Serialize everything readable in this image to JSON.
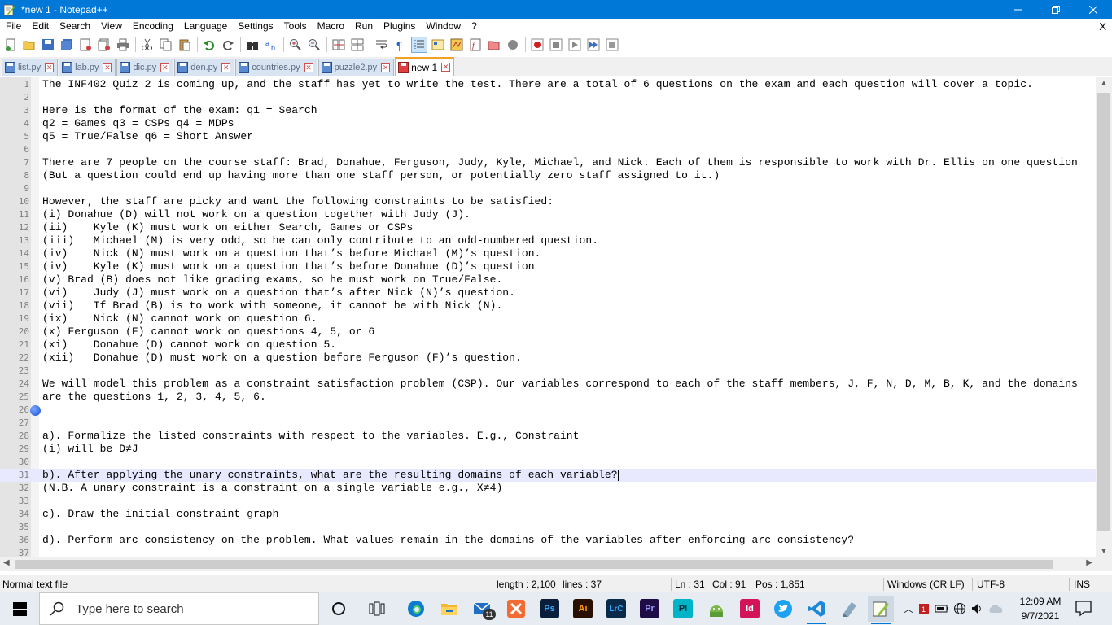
{
  "window": {
    "title": "*new 1 - Notepad++",
    "minimize": "—",
    "restore": "❐",
    "close": "✕"
  },
  "menu": {
    "items": [
      "File",
      "Edit",
      "Search",
      "View",
      "Encoding",
      "Language",
      "Settings",
      "Tools",
      "Macro",
      "Run",
      "Plugins",
      "Window",
      "?"
    ],
    "close_doc": "X"
  },
  "tabs": [
    {
      "label": "list.py",
      "active": false
    },
    {
      "label": "lab.py",
      "active": false
    },
    {
      "label": "dic.py",
      "active": false
    },
    {
      "label": "den.py",
      "active": false
    },
    {
      "label": "countries.py",
      "active": false
    },
    {
      "label": "puzzle2.py",
      "active": false
    },
    {
      "label": "new 1",
      "active": true
    }
  ],
  "editor": {
    "current_line": 31,
    "bookmark_line": 26,
    "lines": [
      "The INF402 Quiz 2 is coming up, and the staff has yet to write the test. There are a total of 6 questions on the exam and each question will cover a topic.",
      "",
      "Here is the format of the exam: q1 = Search",
      "q2 = Games q3 = CSPs q4 = MDPs",
      "q5 = True/False q6 = Short Answer",
      "",
      "There are 7 people on the course staff: Brad, Donahue, Ferguson, Judy, Kyle, Michael, and Nick. Each of them is responsible to work with Dr. Ellis on one question",
      "(But a question could end up having more than one staff person, or potentially zero staff assigned to it.)",
      "",
      "However, the staff are picky and want the following constraints to be satisfied:",
      "(i) Donahue (D) will not work on a question together with Judy (J).",
      "(ii)    Kyle (K) must work on either Search, Games or CSPs",
      "(iii)   Michael (M) is very odd, so he can only contribute to an odd-numbered question.",
      "(iv)    Nick (N) must work on a question that’s before Michael (M)’s question.",
      "(iv)    Kyle (K) must work on a question that’s before Donahue (D)’s question",
      "(v) Brad (B) does not like grading exams, so he must work on True/False.",
      "(vi)    Judy (J) must work on a question that’s after Nick (N)’s question.",
      "(vii)   If Brad (B) is to work with someone, it cannot be with Nick (N).",
      "(ix)    Nick (N) cannot work on question 6.",
      "(x) Ferguson (F) cannot work on questions 4, 5, or 6",
      "(xi)    Donahue (D) cannot work on question 5.",
      "(xii)   Donahue (D) must work on a question before Ferguson (F)’s question.",
      "",
      "We will model this problem as a constraint satisfaction problem (CSP). Our variables correspond to each of the staff members, J, F, N, D, M, B, K, and the domains",
      "are the questions 1, 2, 3, 4, 5, 6.",
      "",
      "",
      "a). Formalize the listed constraints with respect to the variables. E.g., Constraint",
      "(i) will be D≠J",
      "",
      "b). After applying the unary constraints, what are the resulting domains of each variable?",
      "(N.B. A unary constraint is a constraint on a single variable e.g., X≠4)",
      "",
      "c). Draw the initial constraint graph",
      "",
      "d). Perform arc consistency on the problem. What values remain in the domains of the variables after enforcing arc consistency?",
      ""
    ]
  },
  "status": {
    "file_type": "Normal text file",
    "length": "length : 2,100",
    "lines": "lines : 37",
    "ln": "Ln : 31",
    "col": "Col : 91",
    "pos": "Pos : 1,851",
    "eol": "Windows (CR LF)",
    "encoding": "UTF-8",
    "mode": "INS"
  },
  "taskbar": {
    "search_placeholder": "Type here to search",
    "mail_badge": "11",
    "time": "12:09 AM",
    "date": "9/7/2021",
    "apps": [
      {
        "name": "cortana-icon",
        "text": "",
        "color": "#000000"
      },
      {
        "name": "task-view-icon",
        "text": "",
        "color": "#000000"
      },
      {
        "name": "edge-icon",
        "text": "",
        "color": "#0c7bd0"
      },
      {
        "name": "file-explorer-icon",
        "text": "",
        "color": "#f2b630"
      },
      {
        "name": "mail-icon",
        "text": "",
        "color": "#1f6fc5"
      },
      {
        "name": "xampp-icon",
        "text": "",
        "color": "#f36a32"
      },
      {
        "name": "photoshop-icon",
        "text": "Ps",
        "color": "#0a1e3c"
      },
      {
        "name": "illustrator-icon",
        "text": "Ai",
        "color": "#2a0e00"
      },
      {
        "name": "lightroom-classic-icon",
        "text": "LrC",
        "color": "#0b2a4a"
      },
      {
        "name": "premiere-pro-icon",
        "text": "Pr",
        "color": "#1f0b45"
      },
      {
        "name": "prelude-icon",
        "text": "Pl",
        "color": "#00b4c8"
      },
      {
        "name": "android-studio-icon",
        "text": "",
        "color": "#7ab648"
      },
      {
        "name": "indesign-icon",
        "text": "Id",
        "color": "#d4145a"
      },
      {
        "name": "twitter-icon",
        "text": "",
        "color": "#1da1f2"
      },
      {
        "name": "vscode-icon",
        "text": "",
        "color": "#1e88d8"
      },
      {
        "name": "unknown-app-icon",
        "text": "",
        "color": "#8aa8c0"
      },
      {
        "name": "notepad-plus-plus-icon",
        "text": "",
        "color": "#90c040"
      }
    ]
  },
  "colors": {
    "titlebar": "#0078d7",
    "current_line": "#e8e8ff",
    "active_tab_accent": "#f4a020"
  }
}
